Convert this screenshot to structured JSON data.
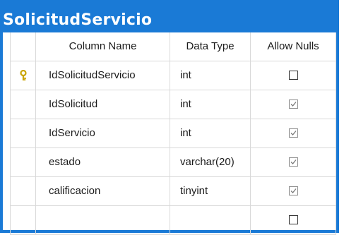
{
  "table": {
    "title": "SolicitudServicio",
    "headers": {
      "column_name": "Column Name",
      "data_type": "Data Type",
      "allow_nulls": "Allow Nulls"
    },
    "columns": [
      {
        "name": "IdSolicitudServicio",
        "type": "int",
        "allow_nulls": false,
        "primary_key": true
      },
      {
        "name": "IdSolicitud",
        "type": "int",
        "allow_nulls": true,
        "primary_key": false
      },
      {
        "name": "IdServicio",
        "type": "int",
        "allow_nulls": true,
        "primary_key": false
      },
      {
        "name": "estado",
        "type": "varchar(20)",
        "allow_nulls": true,
        "primary_key": false
      },
      {
        "name": "calificacion",
        "type": "tinyint",
        "allow_nulls": true,
        "primary_key": false
      },
      {
        "name": "",
        "type": "",
        "allow_nulls": false,
        "primary_key": false
      }
    ]
  },
  "colors": {
    "title_bar": "#1a7ad6",
    "grid_lines": "#d9d9d9",
    "key_icon": "#c9a400"
  },
  "icons": {
    "primary_key": "key-icon",
    "checkbox": "checkbox-icon"
  }
}
